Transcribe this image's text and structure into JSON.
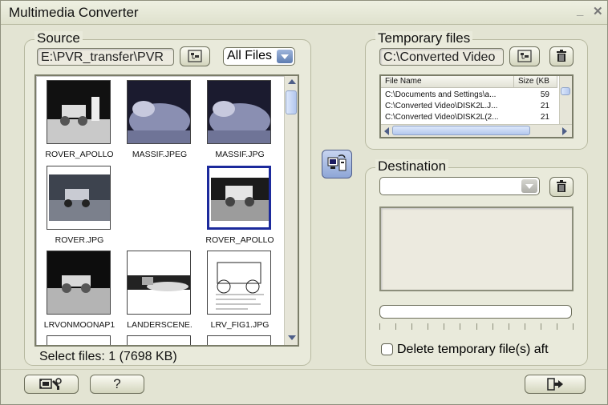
{
  "window": {
    "title": "Multimedia Converter"
  },
  "source": {
    "title": "Source",
    "path": "E:\\PVR_transfer\\PVR",
    "filter": "All Files",
    "status": "Select files: 1 (7698 KB)",
    "files": [
      {
        "name": "ROVER_APOLLO",
        "selected": false,
        "art": "rover"
      },
      {
        "name": "MASSIF.JPEG",
        "selected": false,
        "art": "rock"
      },
      {
        "name": "MASSIF.JPG",
        "selected": false,
        "art": "rock"
      },
      {
        "name": "ROVER.JPG",
        "selected": false,
        "art": "rover2"
      },
      {
        "name": "ROVER_APOLLO",
        "selected": true,
        "art": "rover3"
      },
      {
        "name": "LRVONMOONAP1",
        "selected": false,
        "art": "rover4"
      },
      {
        "name": "LANDERSCENE.",
        "selected": false,
        "art": "lander"
      },
      {
        "name": "LRV_FIG1.JPG",
        "selected": false,
        "art": "diagram"
      }
    ]
  },
  "temporary": {
    "title": "Temporary files",
    "path": "C:\\Converted Video",
    "columns": [
      "File Name",
      "Size (KB"
    ],
    "rows": [
      {
        "name": "C:\\Documents and Settings\\a...",
        "size": "59"
      },
      {
        "name": "C:\\Converted Video\\DISK2L.J...",
        "size": "21"
      },
      {
        "name": "C:\\Converted Video\\DISK2L(2...",
        "size": "21"
      }
    ]
  },
  "destination": {
    "title": "Destination",
    "value": "",
    "delete_temp_label": "Delete temporary file(s) aft",
    "delete_temp_checked": false
  },
  "footer": {
    "help_label": "?"
  },
  "colors": {
    "accent": "#1c2a9c",
    "panel": "#e9eadb"
  }
}
